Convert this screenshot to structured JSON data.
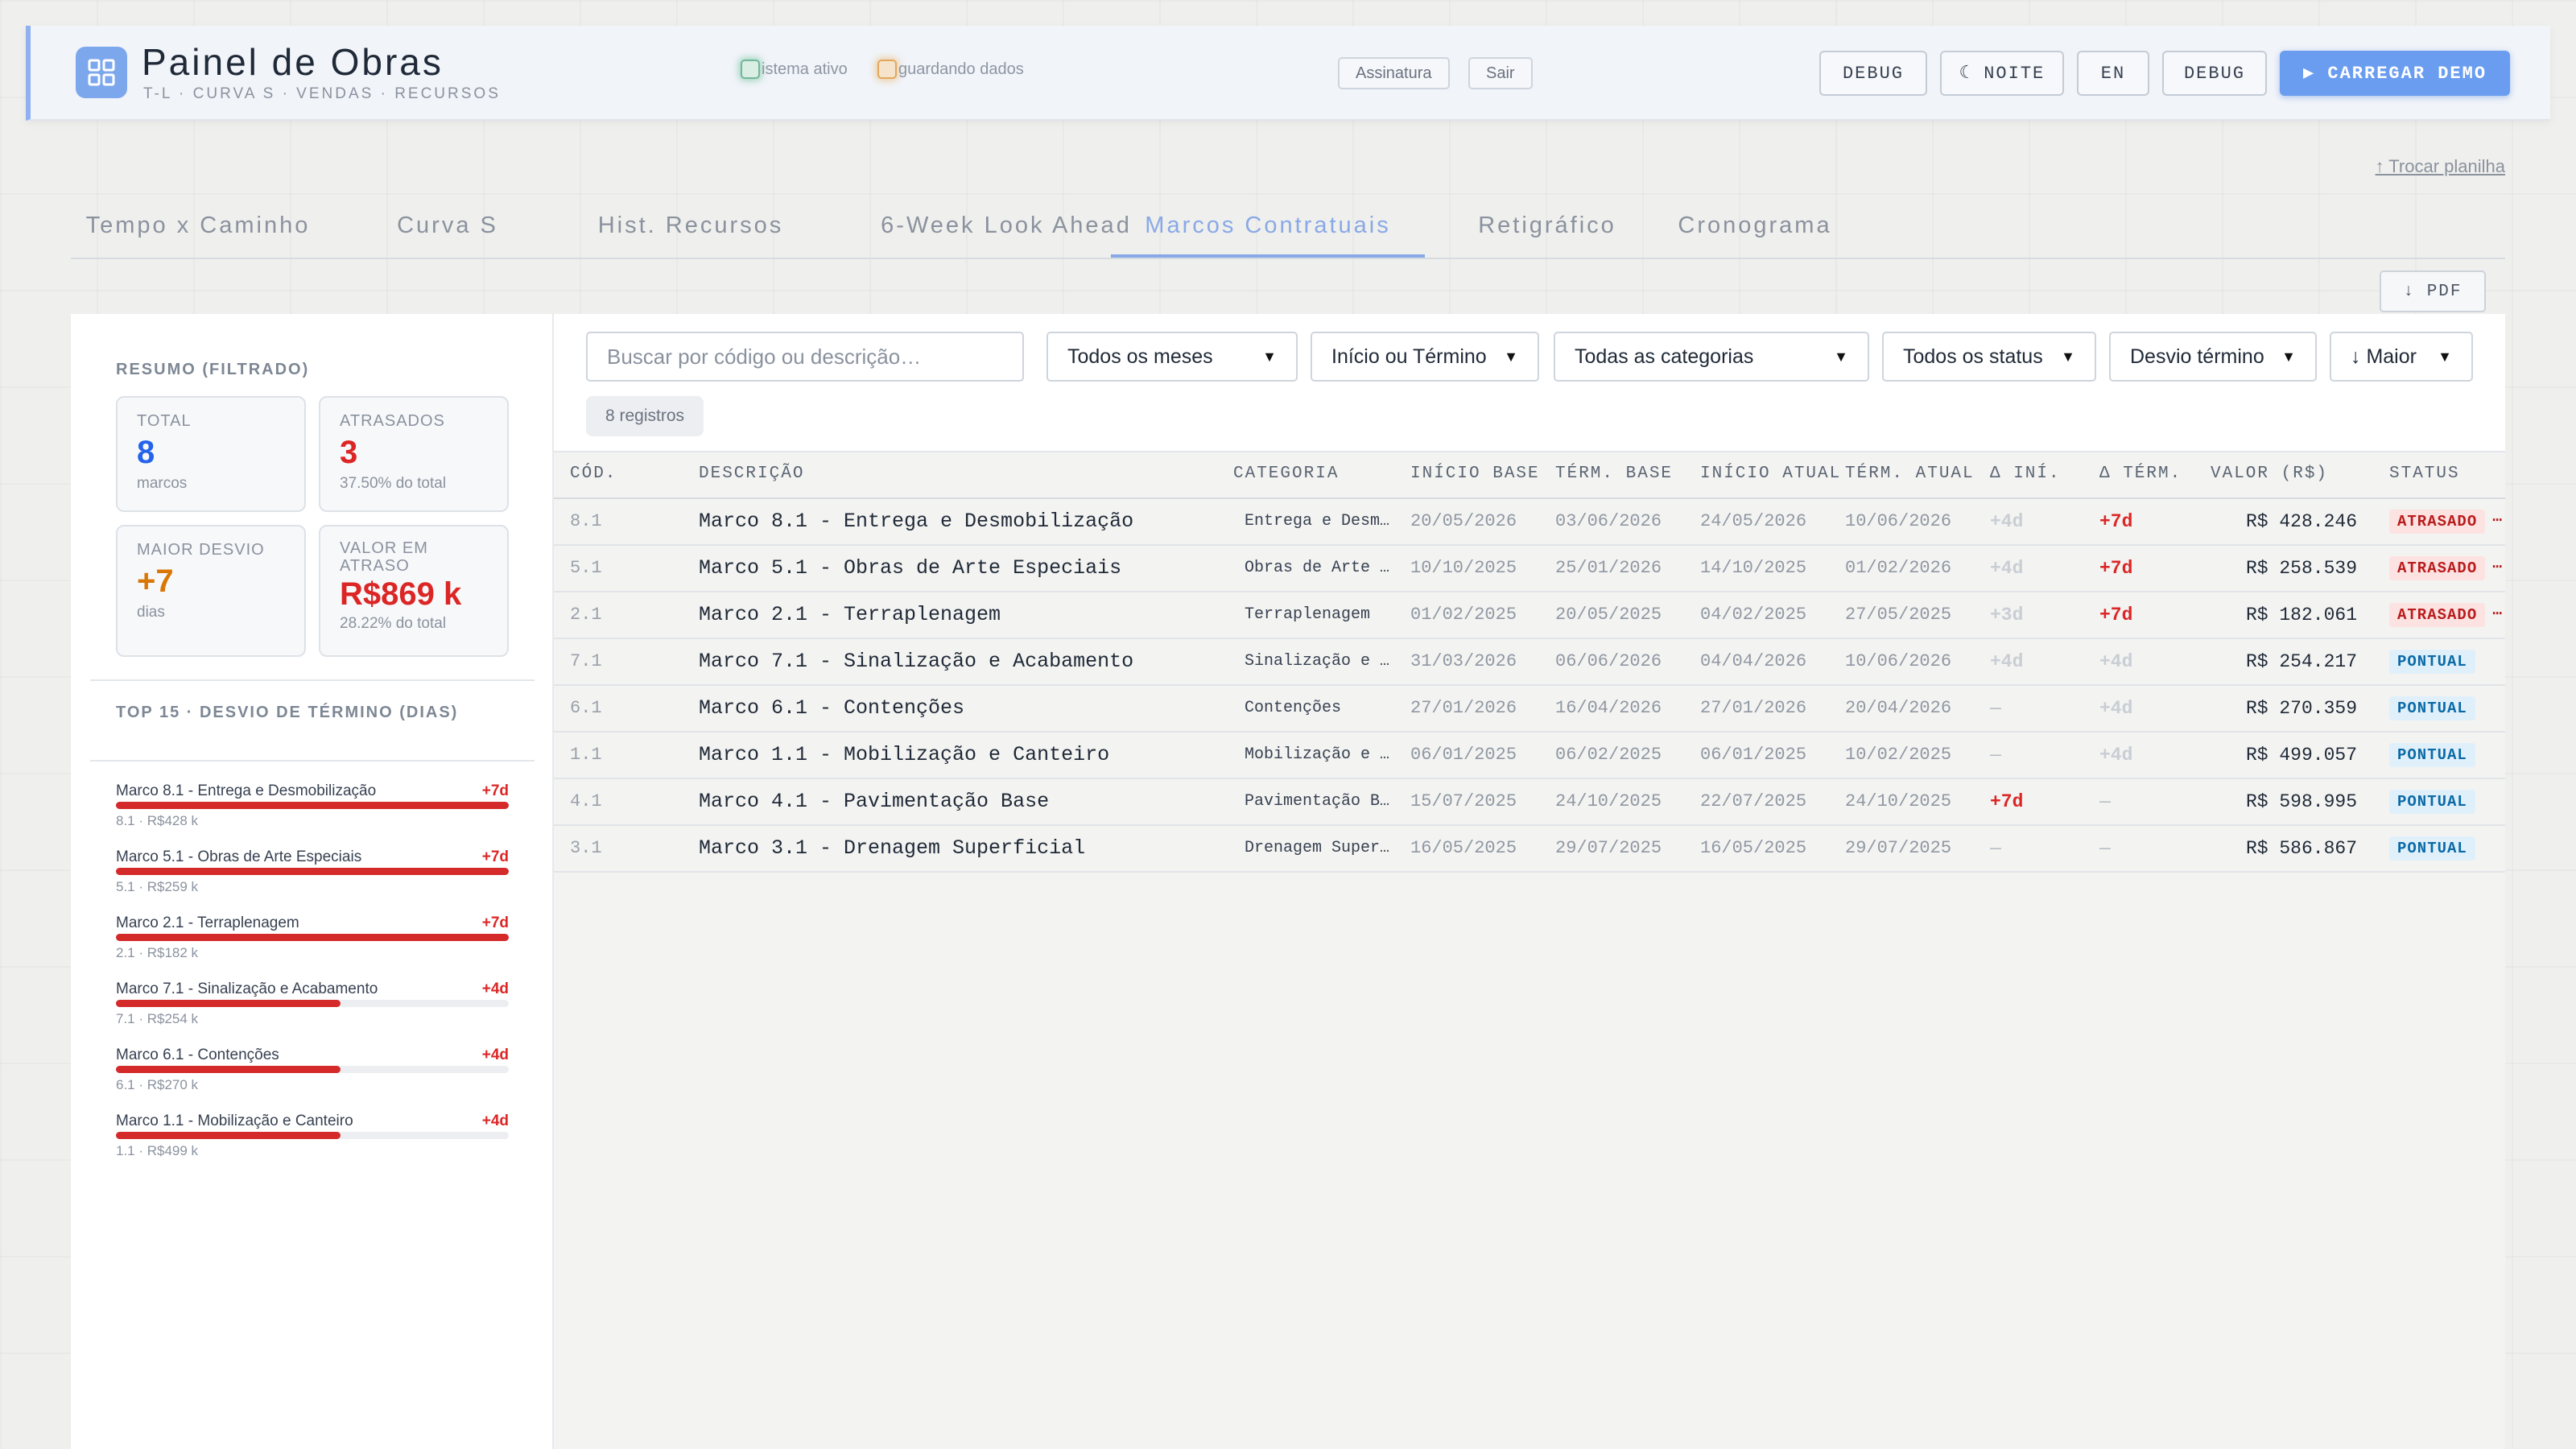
{
  "header": {
    "title": "Painel de Obras",
    "subtitle": "T-L · CURVA S · VENDAS · RECURSOS",
    "status_system": "istema ativo",
    "status_saving": "guardando dados",
    "signature_btn": "Assinatura",
    "exit_btn": "Sair",
    "debug_btn_1": "DEBUG",
    "night_btn": "☾ NOITE",
    "lang_btn": "EN",
    "debug_btn_2": "DEBUG",
    "demo_btn": "▶ CARREGAR DEMO"
  },
  "swap_link": "↑ Trocar planilha",
  "tabs": [
    {
      "label": "Tempo x Caminho"
    },
    {
      "label": "Curva S"
    },
    {
      "label": "Hist. Recursos"
    },
    {
      "label": "6-Week Look Ahead"
    },
    {
      "label": "Marcos Contratuais"
    },
    {
      "label": "Retigráfico"
    },
    {
      "label": "Cronograma"
    }
  ],
  "active_tab": "Marcos Contratuais",
  "pdf_btn": "↓ PDF",
  "summary": {
    "title": "RESUMO (FILTRADO)",
    "cards": [
      {
        "label": "TOTAL",
        "value": "8",
        "sub": "marcos",
        "color": "#2563eb"
      },
      {
        "label": "ATRASADOS",
        "value": "3",
        "sub": "37.50% do total",
        "color": "#dc2626"
      },
      {
        "label": "MAIOR DESVIO",
        "value": "+7",
        "sub": "dias",
        "color": "#d97706"
      },
      {
        "label": "VALOR EM ATRASO",
        "value": "R$869 k",
        "sub": "28.22% do total",
        "color": "#dc2626"
      }
    ]
  },
  "top_deviation": {
    "title": "TOP 15 · DESVIO DE TÉRMINO (DIAS)",
    "max_days": 7,
    "items": [
      {
        "name": "Marco 8.1 - Entrega e Desmobilização",
        "delta": "+7d",
        "days": 7,
        "sub": "8.1 · R$428 k"
      },
      {
        "name": "Marco 5.1 - Obras de Arte Especiais",
        "delta": "+7d",
        "days": 7,
        "sub": "5.1 · R$259 k"
      },
      {
        "name": "Marco 2.1 - Terraplenagem",
        "delta": "+7d",
        "days": 7,
        "sub": "2.1 · R$182 k"
      },
      {
        "name": "Marco 7.1 - Sinalização e Acabamento",
        "delta": "+4d",
        "days": 4,
        "sub": "7.1 · R$254 k"
      },
      {
        "name": "Marco 6.1 - Contenções",
        "delta": "+4d",
        "days": 4,
        "sub": "6.1 · R$270 k"
      },
      {
        "name": "Marco 1.1 - Mobilização e Canteiro",
        "delta": "+4d",
        "days": 4,
        "sub": "1.1 · R$499 k"
      }
    ]
  },
  "filters": {
    "search_placeholder": "Buscar por código ou descrição…",
    "month": "Todos os meses",
    "date_type": "Início ou Término",
    "category": "Todas as categorias",
    "status": "Todos os status",
    "sort_field": "Desvio término",
    "sort_order": "↓ Maior",
    "count": "8 registros"
  },
  "table": {
    "headers": {
      "code": "CÓD.",
      "desc": "DESCRIÇÃO",
      "cat": "CATEGORIA",
      "start_base": "INÍCIO BASE",
      "end_base": "TÉRM. BASE",
      "start_cur": "INÍCIO ATUAL",
      "end_cur": "TÉRM. ATUAL",
      "d_start": "Δ INÍ.",
      "d_end": "Δ TÉRM.",
      "value": "VALOR (R$)",
      "status": "STATUS"
    },
    "rows": [
      {
        "code": "8.1",
        "desc": "Marco 8.1 - Entrega e Desmobilização",
        "cat": "Entrega e Desmobilização",
        "start_base": "20/05/2026",
        "end_base": "03/06/2026",
        "start_cur": "24/05/2026",
        "end_cur": "10/06/2026",
        "d_start": "+4d",
        "d_end": "+7d",
        "value": "R$ 428.246",
        "status": "ATRASADO",
        "late": true
      },
      {
        "code": "5.1",
        "desc": "Marco 5.1 - Obras de Arte Especiais",
        "cat": "Obras de Arte Especiais",
        "start_base": "10/10/2025",
        "end_base": "25/01/2026",
        "start_cur": "14/10/2025",
        "end_cur": "01/02/2026",
        "d_start": "+4d",
        "d_end": "+7d",
        "value": "R$ 258.539",
        "status": "ATRASADO",
        "late": true
      },
      {
        "code": "2.1",
        "desc": "Marco 2.1 - Terraplenagem",
        "cat": "Terraplenagem",
        "start_base": "01/02/2025",
        "end_base": "20/05/2025",
        "start_cur": "04/02/2025",
        "end_cur": "27/05/2025",
        "d_start": "+3d",
        "d_end": "+7d",
        "value": "R$ 182.061",
        "status": "ATRASADO",
        "late": true
      },
      {
        "code": "7.1",
        "desc": "Marco 7.1 - Sinalização e Acabamento",
        "cat": "Sinalização e Acabamento",
        "start_base": "31/03/2026",
        "end_base": "06/06/2026",
        "start_cur": "04/04/2026",
        "end_cur": "10/06/2026",
        "d_start": "+4d",
        "d_end": "+4d",
        "value": "R$ 254.217",
        "status": "PONTUAL",
        "late": false
      },
      {
        "code": "6.1",
        "desc": "Marco 6.1 - Contenções",
        "cat": "Contenções",
        "start_base": "27/01/2026",
        "end_base": "16/04/2026",
        "start_cur": "27/01/2026",
        "end_cur": "20/04/2026",
        "d_start": "—",
        "d_end": "+4d",
        "value": "R$ 270.359",
        "status": "PONTUAL",
        "late": false
      },
      {
        "code": "1.1",
        "desc": "Marco 1.1 - Mobilização e Canteiro",
        "cat": "Mobilização e Canteiro",
        "start_base": "06/01/2025",
        "end_base": "06/02/2025",
        "start_cur": "06/01/2025",
        "end_cur": "10/02/2025",
        "d_start": "—",
        "d_end": "+4d",
        "value": "R$ 499.057",
        "status": "PONTUAL",
        "late": false
      },
      {
        "code": "4.1",
        "desc": "Marco 4.1 - Pavimentação Base",
        "cat": "Pavimentação Base",
        "start_base": "15/07/2025",
        "end_base": "24/10/2025",
        "start_cur": "22/07/2025",
        "end_cur": "24/10/2025",
        "d_start": "+7d",
        "d_end": "—",
        "value": "R$ 598.995",
        "status": "PONTUAL",
        "late": false
      },
      {
        "code": "3.1",
        "desc": "Marco 3.1 - Drenagem Superficial",
        "cat": "Drenagem Superficial",
        "start_base": "16/05/2025",
        "end_base": "29/07/2025",
        "start_cur": "16/05/2025",
        "end_cur": "29/07/2025",
        "d_start": "—",
        "d_end": "—",
        "value": "R$ 586.867",
        "status": "PONTUAL",
        "late": false
      }
    ]
  }
}
